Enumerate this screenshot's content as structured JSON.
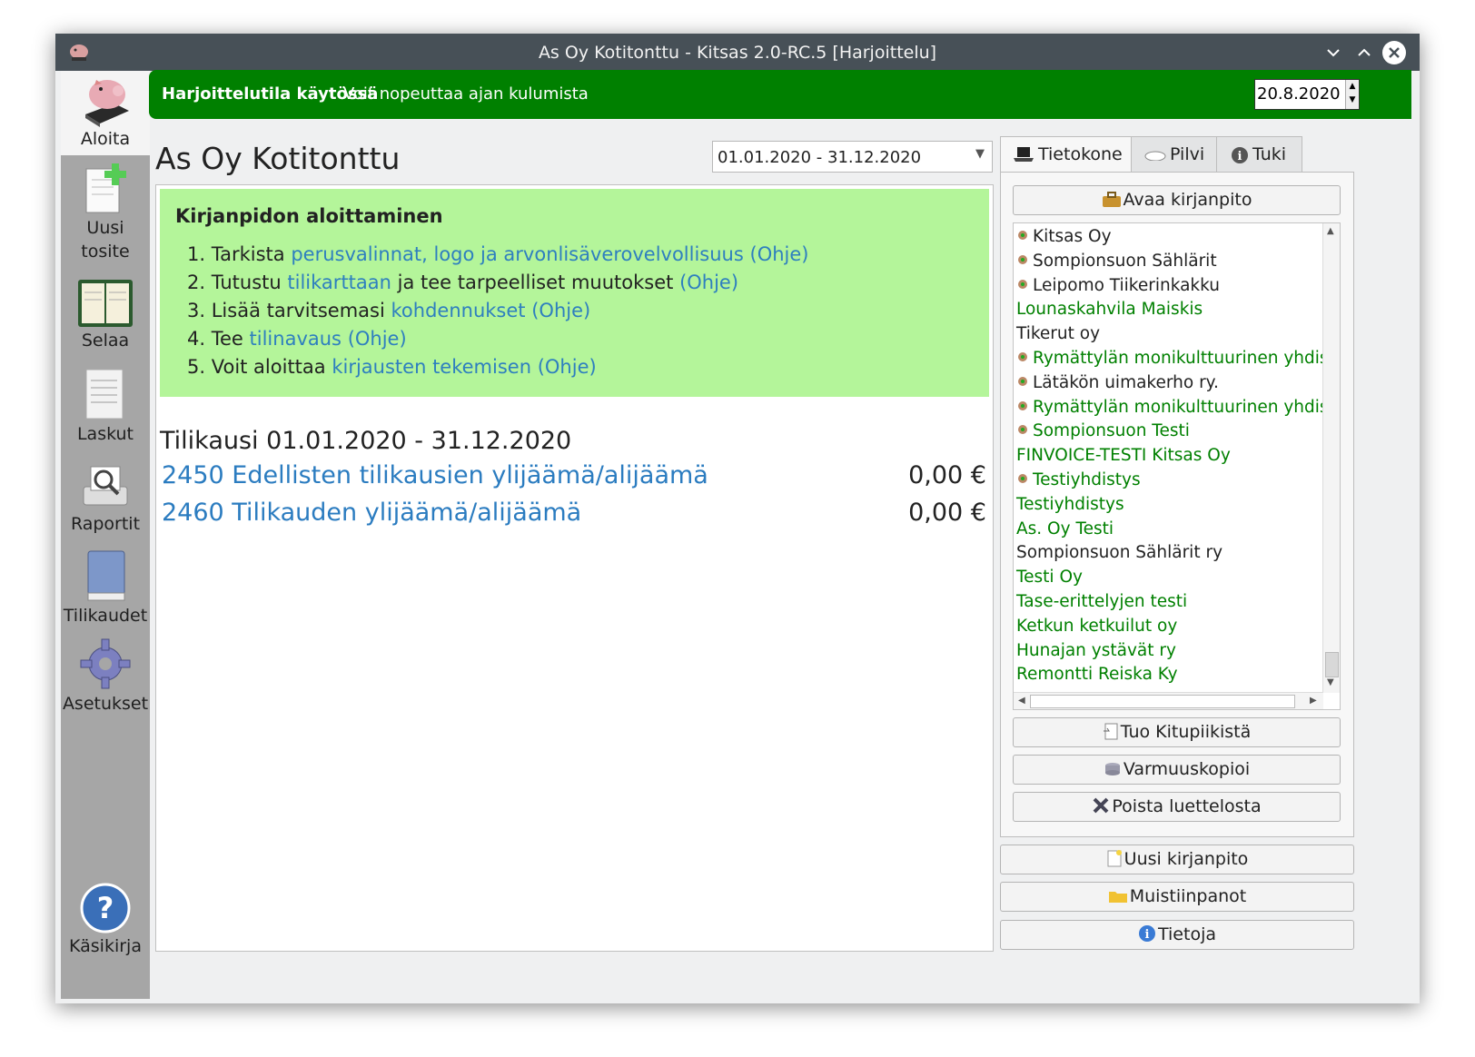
{
  "window": {
    "title": "As Oy Kotitonttu - Kitsas 2.0-RC.5 [Harjoittelu]",
    "minimize": "⌄",
    "maximize": "⌃",
    "close": "✕"
  },
  "sidebar": {
    "items": [
      {
        "label": "Aloita",
        "icon": "piggy-bank-icon"
      },
      {
        "label": "Uusi\ntosite",
        "label1": "Uusi",
        "label2": "tosite",
        "icon": "new-document-icon"
      },
      {
        "label": "Selaa",
        "icon": "ledger-book-icon"
      },
      {
        "label": "Laskut",
        "icon": "invoice-icon"
      },
      {
        "label": "Raportit",
        "icon": "report-printer-icon"
      },
      {
        "label": "Tilikaudet",
        "icon": "book-icon"
      },
      {
        "label": "Asetukset",
        "icon": "gear-icon"
      },
      {
        "label": "Käsikirja",
        "icon": "help-icon"
      }
    ]
  },
  "banner": {
    "bold_text": "Harjoittelutila käytössä",
    "text": "Voit nopeuttaa ajan kulumista",
    "date": "20.8.2020",
    "color": "#008000"
  },
  "main": {
    "company": "As Oy Kotitonttu",
    "period_select": "01.01.2020 - 31.12.2020",
    "start": {
      "heading": "Kirjanpidon aloittaminen",
      "steps": [
        {
          "num": "1.",
          "pre": "Tarkista",
          "link": "perusvalinnat, logo ja arvonlisäverovelvollisuus",
          "mid": "",
          "help": "(Ohje)"
        },
        {
          "num": "2.",
          "pre": "Tutustu",
          "link": "tilikarttaan",
          "mid": "ja tee tarpeelliset muutokset",
          "help": "(Ohje)"
        },
        {
          "num": "3.",
          "pre": "Lisää tarvitsemasi",
          "link": "kohdennukset",
          "mid": "",
          "help": "(Ohje)"
        },
        {
          "num": "4.",
          "pre": "Tee",
          "link": "tilinavaus",
          "mid": "",
          "help": "(Ohje)"
        },
        {
          "num": "5.",
          "pre": "Voit aloittaa",
          "link": "kirjausten tekemisen",
          "mid": "",
          "help": "(Ohje)"
        }
      ]
    },
    "period_heading": "Tilikausi 01.01.2020 - 31.12.2020",
    "accounts": [
      {
        "name": "2450 Edellisten tilikausien ylijäämä/alijäämä",
        "amount": "0,00 €"
      },
      {
        "name": "2460 Tilikauden ylijäämä/alijäämä",
        "amount": "0,00 €"
      }
    ]
  },
  "right": {
    "tabs": [
      {
        "label": "Tietokone",
        "icon": "laptop-icon"
      },
      {
        "label": "Pilvi",
        "icon": "cloud-icon"
      },
      {
        "label": "Tuki",
        "icon": "info-icon"
      }
    ],
    "open_button": "Avaa kirjanpito",
    "companies": [
      {
        "name": "Kitsas Oy",
        "color": "black",
        "icon": "logo-icon"
      },
      {
        "name": "Sompionsuon Sählärit",
        "color": "black",
        "icon": "logo-icon"
      },
      {
        "name": "Leipomo Tiikerinkakku",
        "color": "black",
        "icon": "logo-icon"
      },
      {
        "name": "Lounaskahvila Maiskis",
        "color": "green",
        "icon": ""
      },
      {
        "name": "Tikerut oy",
        "color": "black",
        "icon": ""
      },
      {
        "name": "Rymättylän monikulttuurinen yhdistys",
        "color": "green",
        "icon": "logo-icon"
      },
      {
        "name": "Lätäkön uimakerho ry.",
        "color": "black",
        "icon": "logo-icon"
      },
      {
        "name": "Rymättylän monikulttuurinen yhdistys",
        "color": "green",
        "icon": "logo-icon"
      },
      {
        "name": "Sompionsuon Testi",
        "color": "green",
        "icon": "logo-icon"
      },
      {
        "name": "FINVOICE-TESTI Kitsas Oy",
        "color": "green",
        "icon": ""
      },
      {
        "name": "Testiyhdistys",
        "color": "green",
        "icon": "logo-icon"
      },
      {
        "name": "Testiyhdistys",
        "color": "green",
        "icon": ""
      },
      {
        "name": "As. Oy Testi",
        "color": "green",
        "icon": ""
      },
      {
        "name": "Sompionsuon Sählärit ry",
        "color": "black",
        "icon": ""
      },
      {
        "name": "Testi Oy",
        "color": "green",
        "icon": ""
      },
      {
        "name": "Tase-erittelyjen testi",
        "color": "green",
        "icon": ""
      },
      {
        "name": "Ketkun ketkuilut oy",
        "color": "green",
        "icon": ""
      },
      {
        "name": "Hunajan ystävät ry",
        "color": "green",
        "icon": ""
      },
      {
        "name": "Remontti Reiska Ky",
        "color": "green",
        "icon": ""
      }
    ],
    "import_button": "Tuo Kitupiikistä",
    "backup_button": "Varmuuskopioi",
    "remove_button": "Poista luettelosta",
    "new_button": "Uusi kirjanpito",
    "notes_button": "Muistiinpanot",
    "about_button": "Tietoja"
  }
}
